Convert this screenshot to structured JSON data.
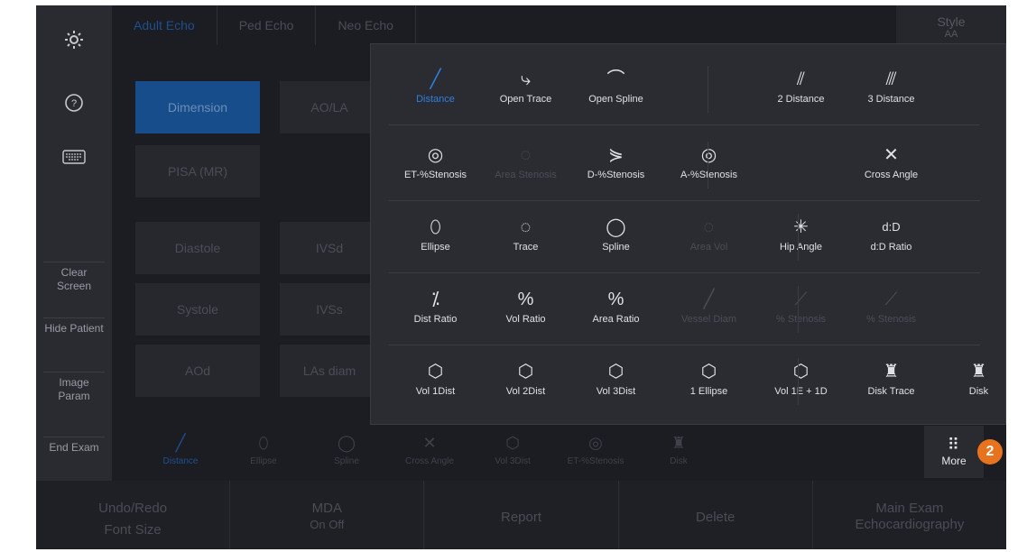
{
  "sidebar": {
    "icons": [
      "gear-icon",
      "help-icon",
      "keyboard-icon"
    ],
    "buttons": [
      {
        "label": "Clear Screen"
      },
      {
        "label": "Hide Patient"
      },
      {
        "label": "Image Param"
      },
      {
        "label": "End Exam"
      }
    ]
  },
  "tabs": [
    {
      "label": "Adult Echo"
    },
    {
      "label": "Ped Echo"
    },
    {
      "label": "Neo Echo"
    }
  ],
  "style_button": {
    "label": "Style",
    "value": "AA"
  },
  "background_buttons": [
    {
      "label": "Dimension"
    },
    {
      "label": "AO/LA"
    },
    {
      "label": "PISA (MR)"
    },
    {
      "label": "Diastole"
    },
    {
      "label": "IVSd"
    },
    {
      "label": "Systole"
    },
    {
      "label": "IVSs"
    },
    {
      "label": "AOd"
    },
    {
      "label": "LAs diam"
    }
  ],
  "popup": {
    "rows": [
      [
        {
          "label": "Distance",
          "icon": "ruler-line-icon",
          "glyph": "╱",
          "state": "selected"
        },
        {
          "label": "Open Trace",
          "icon": "open-trace-icon",
          "glyph": "⤷",
          "state": "normal"
        },
        {
          "label": "Open Spline",
          "icon": "open-spline-icon",
          "glyph": "⌒",
          "state": "normal"
        },
        {
          "label": "2 Distance",
          "icon": "two-distance-icon",
          "glyph": "⫽",
          "state": "normal"
        },
        {
          "label": "3 Distance",
          "icon": "three-distance-icon",
          "glyph": "⫻",
          "state": "normal"
        }
      ],
      [
        {
          "label": "ET-%Stenosis",
          "icon": "et-stenosis-icon",
          "glyph": "◎",
          "state": "normal"
        },
        {
          "label": "Area Stenosis",
          "icon": "area-stenosis-icon",
          "glyph": "◌",
          "state": "disabled"
        },
        {
          "label": "D-%Stenosis",
          "icon": "d-stenosis-icon",
          "glyph": "⋟",
          "state": "normal"
        },
        {
          "label": "A-%Stenosis",
          "icon": "a-stenosis-icon",
          "glyph": "◎",
          "state": "normal"
        },
        {
          "label": "Cross Angle",
          "icon": "cross-angle-icon",
          "glyph": "✕",
          "state": "normal"
        }
      ],
      [
        {
          "label": "Ellipse",
          "icon": "ellipse-icon",
          "glyph": "⬯",
          "state": "normal"
        },
        {
          "label": "Trace",
          "icon": "trace-icon",
          "glyph": "◌",
          "state": "normal"
        },
        {
          "label": "Spline",
          "icon": "spline-icon",
          "glyph": "◯",
          "state": "normal"
        },
        {
          "label": "Area Vol",
          "icon": "area-vol-icon",
          "glyph": "◌",
          "state": "disabled"
        },
        {
          "label": "Hip Angle",
          "icon": "hip-angle-icon",
          "glyph": "✳",
          "state": "normal"
        },
        {
          "label": "d:D Ratio",
          "icon": "dd-ratio-icon",
          "glyph": "d:D",
          "state": "normal"
        }
      ],
      [
        {
          "label": "Dist Ratio",
          "icon": "dist-ratio-icon",
          "glyph": "⁒",
          "state": "normal"
        },
        {
          "label": "Vol Ratio",
          "icon": "vol-ratio-icon",
          "glyph": "%",
          "state": "normal"
        },
        {
          "label": "Area Ratio",
          "icon": "area-ratio-icon",
          "glyph": "%",
          "state": "normal"
        },
        {
          "label": "Vessel Diam",
          "icon": "vessel-diam-icon",
          "glyph": "╱",
          "state": "disabled"
        },
        {
          "label": "% Stenosis",
          "icon": "stenosis-a-icon",
          "glyph": "⟋",
          "state": "disabled"
        },
        {
          "label": "% Stenosis",
          "icon": "stenosis-b-icon",
          "glyph": "⟋",
          "state": "disabled"
        }
      ],
      [
        {
          "label": "Vol 1Dist",
          "icon": "vol-1dist-icon",
          "glyph": "⬡",
          "state": "normal"
        },
        {
          "label": "Vol 2Dist",
          "icon": "vol-2dist-icon",
          "glyph": "⬡",
          "state": "normal"
        },
        {
          "label": "Vol 3Dist",
          "icon": "vol-3dist-icon",
          "glyph": "⬡",
          "state": "normal"
        },
        {
          "label": "1 Ellipse",
          "icon": "one-ellipse-icon",
          "glyph": "⬡",
          "state": "normal"
        },
        {
          "label": "Vol 1E + 1D",
          "icon": "vol-1e1d-icon",
          "glyph": "⬡",
          "state": "normal"
        },
        {
          "label": "Disk Trace",
          "icon": "disk-trace-icon",
          "glyph": "♜",
          "state": "normal"
        },
        {
          "label": "Disk",
          "icon": "disk-icon",
          "glyph": "♜",
          "state": "normal"
        }
      ]
    ]
  },
  "quickbar": [
    {
      "label": "Distance",
      "icon": "ruler-line-icon",
      "glyph": "╱"
    },
    {
      "label": "Ellipse",
      "icon": "ellipse-icon",
      "glyph": "⬯"
    },
    {
      "label": "Spline",
      "icon": "spline-icon",
      "glyph": "◯"
    },
    {
      "label": "Cross Angle",
      "icon": "cross-angle-icon",
      "glyph": "✕"
    },
    {
      "label": "Vol 3Dist",
      "icon": "vol-3dist-icon",
      "glyph": "⬡"
    },
    {
      "label": "ET-%Stenosis",
      "icon": "et-stenosis-icon",
      "glyph": "◎"
    },
    {
      "label": "Disk",
      "icon": "disk-icon",
      "glyph": "♜"
    }
  ],
  "more_button": {
    "label": "More",
    "glyph": "⠿"
  },
  "badge": "2",
  "softkeys": [
    {
      "top": "Undo/Redo",
      "bottom": "Font Size"
    },
    {
      "top": "MDA",
      "bottom": "On  Off"
    },
    {
      "top": "Report",
      "bottom": ""
    },
    {
      "top": "Delete",
      "bottom": ""
    },
    {
      "top": "Main Exam",
      "bottom": "Echocardiography"
    }
  ],
  "colors": {
    "accent": "#2e7fe0",
    "badge": "#e8731f"
  }
}
